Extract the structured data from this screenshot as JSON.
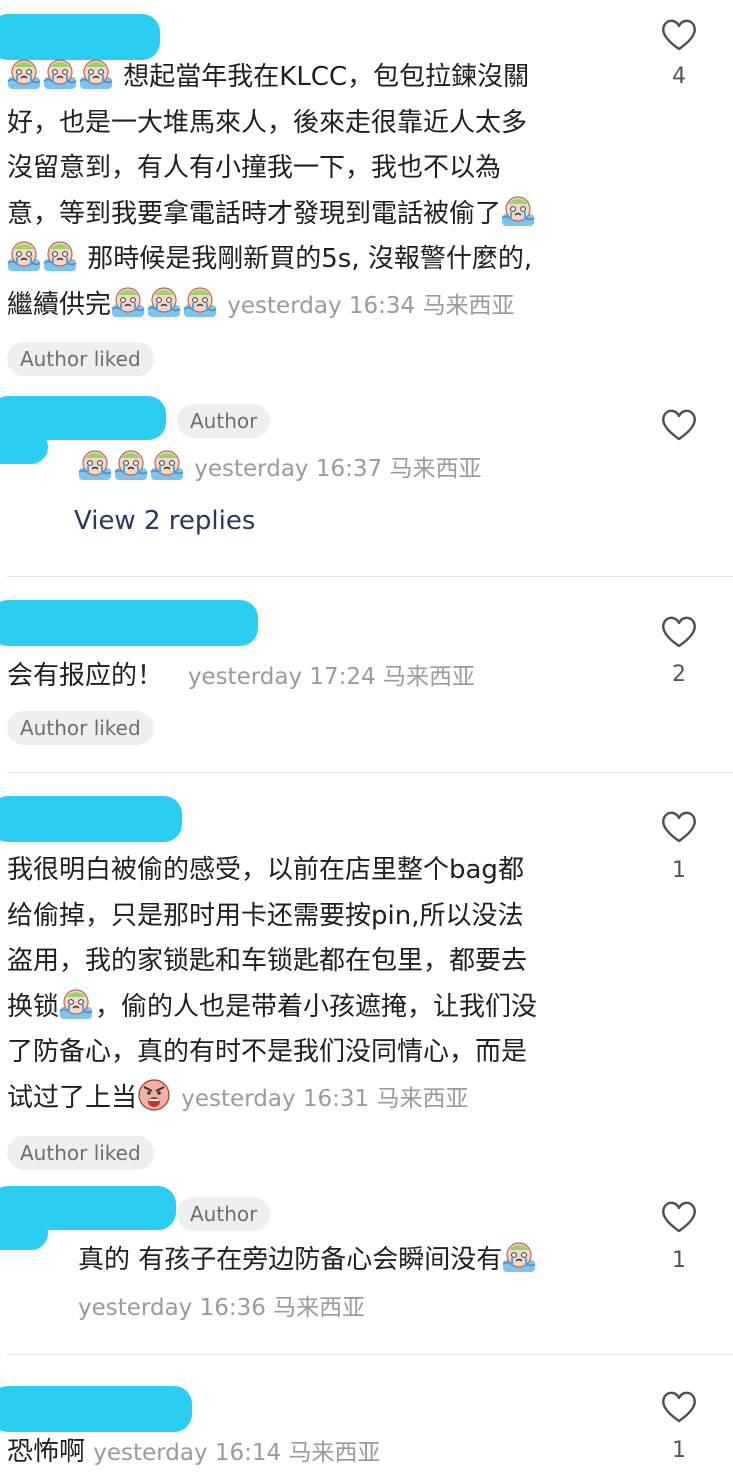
{
  "comments": [
    {
      "line1": "想起當年我在KLCC，包包拉鍊沒關",
      "line2": "好，也是一大堆馬來人，後來走很靠近人太多",
      "line3": "沒留意到，有人有小撞我一下，我也不以為",
      "line4": "意，等到我要拿電話時才發現到電話被偷了",
      "line5": "那時候是我剛新買的5s, 沒報警什麼的,",
      "line6": "繼續供完",
      "time": "yesterday 16:34 马来西亚",
      "likes": "4",
      "author_liked": "Author liked"
    },
    {
      "badge": "Author",
      "time": "yesterday 16:37 马来西亚",
      "view_replies": "View 2 replies"
    },
    {
      "text": "会有报应的！",
      "time": "yesterday 17:24 马来西亚",
      "likes": "2",
      "author_liked": "Author liked"
    },
    {
      "line1": "我很明白被偷的感受，以前在店里整个bag都",
      "line2": "给偷掉，只是那时用卡还需要按pin,所以没法",
      "line3": "盗用，我的家锁匙和车锁匙都在包里，都要去",
      "line4": "换锁",
      "line4b": "，偷的人也是带着小孩遮掩，让我们没",
      "line5": "了防备心，真的有时不是我们没同情心，而是",
      "line6": "试过了上当",
      "time": "yesterday 16:31 马来西亚",
      "likes": "1",
      "author_liked": "Author liked"
    },
    {
      "badge": "Author",
      "text": "真的 有孩子在旁边防备心会瞬间没有",
      "time": "yesterday 16:36 马来西亚",
      "likes": "1"
    },
    {
      "text": "恐怖啊",
      "time": "yesterday 16:14 马来西亚",
      "likes": "1"
    }
  ],
  "colors": {
    "redaction": "#2bcdf0",
    "link": "#243a5e",
    "timestamp": "#9b9b9b"
  },
  "icons": {
    "like": "heart-outline-icon",
    "crying": "crying-face-emoji",
    "angry": "angry-face-emoji"
  }
}
